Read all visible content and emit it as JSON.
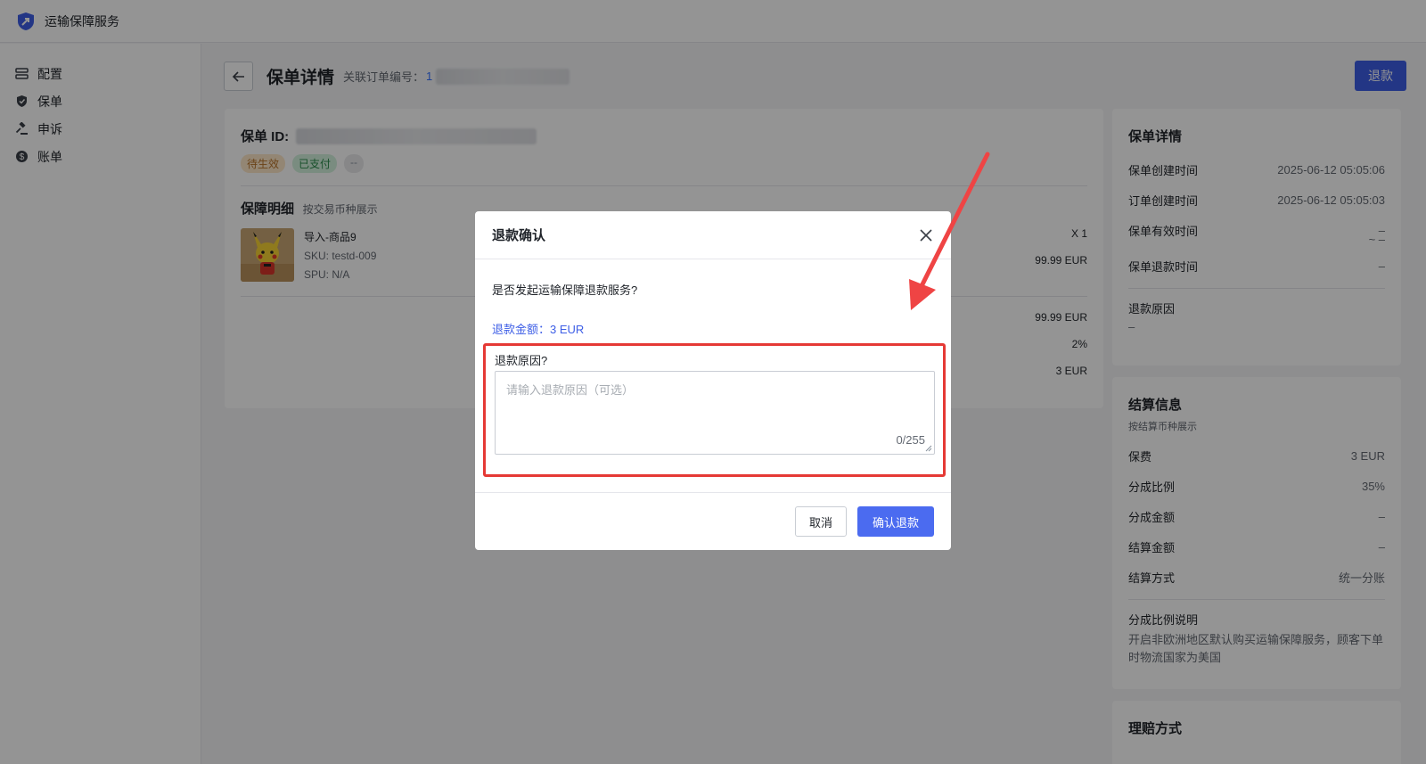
{
  "app": {
    "brand": "运输保障服务"
  },
  "sidebar": {
    "items": [
      {
        "label": "配置",
        "icon": "config-icon"
      },
      {
        "label": "保单",
        "icon": "shield-icon"
      },
      {
        "label": "申诉",
        "icon": "gavel-icon"
      },
      {
        "label": "账单",
        "icon": "dollar-icon"
      }
    ]
  },
  "header": {
    "title": "保单详情",
    "order_label": "关联订单编号：",
    "order_value": "1",
    "refund_button": "退款"
  },
  "policy": {
    "id_label": "保单 ID:",
    "tags": [
      "待生效",
      "已支付",
      "--"
    ],
    "coverage_title": "保障明细",
    "coverage_sub": "按交易币种展示",
    "product": {
      "name": "导入-商品9",
      "sku": "SKU: testd-009",
      "spu": "SPU: N/A",
      "qty": "X 1",
      "price": "99.99 EUR",
      "subtotal": "99.99 EUR",
      "rate": "2%",
      "fee": "3 EUR"
    }
  },
  "details_card": {
    "title": "保单详情",
    "rows": [
      {
        "k": "保单创建时间",
        "v": "2025-06-12 05:05:06"
      },
      {
        "k": "订单创建时间",
        "v": "2025-06-12 05:05:03"
      },
      {
        "k": "保单有效时间",
        "v": "–"
      },
      {
        "k": "保单退款时间",
        "v": "–"
      }
    ],
    "validity_extra": "~ –",
    "reason_label": "退款原因",
    "reason_value": "–"
  },
  "settlement_card": {
    "title": "结算信息",
    "sub": "按结算币种展示",
    "rows": [
      {
        "k": "保费",
        "v": "3 EUR"
      },
      {
        "k": "分成比例",
        "v": "35%"
      },
      {
        "k": "分成金额",
        "v": "–"
      },
      {
        "k": "结算金额",
        "v": "–"
      },
      {
        "k": "结算方式",
        "v": "统一分账"
      }
    ],
    "note_title": "分成比例说明",
    "note_text": "开启非欧洲地区默认购买运输保障服务，顾客下单时物流国家为美国"
  },
  "claim_card": {
    "title": "理赔方式"
  },
  "modal": {
    "title": "退款确认",
    "question": "是否发起运输保障退款服务?",
    "amount": "退款金额：3 EUR",
    "reason_label": "退款原因?",
    "reason_placeholder": "请输入退款原因（可选）",
    "char_count": "0/255",
    "cancel": "取消",
    "confirm": "确认退款"
  }
}
